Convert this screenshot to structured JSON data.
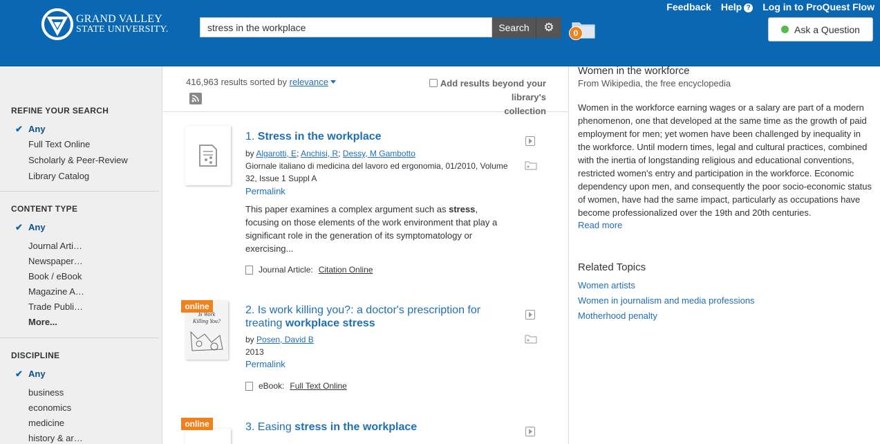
{
  "header": {
    "logo_line1": "GRAND VALLEY",
    "logo_line2": "STATE UNIVERSITY.",
    "search_value": "stress in the workplace",
    "search_button": "Search",
    "folder_count": "0",
    "feedback": "Feedback",
    "help": "Help",
    "help_q": "?",
    "login": "Log in to ProQuest Flow",
    "ask": "Ask a Question"
  },
  "sidebar": {
    "refine_title": "REFINE YOUR SEARCH",
    "refine_items": [
      "Any",
      "Full Text Online",
      "Scholarly & Peer-Review",
      "Library Catalog"
    ],
    "content_title": "CONTENT TYPE",
    "content_items": [
      "Any",
      "Journal Arti…",
      "Newspaper…",
      "Book / eBook",
      "Magazine A…",
      "Trade Publi…",
      "More..."
    ],
    "discipline_title": "DISCIPLINE",
    "discipline_items": [
      "Any",
      "business",
      "economics",
      "medicine",
      "history & ar…"
    ]
  },
  "results_header": {
    "count_text": "416,963 results sorted by",
    "sort_value": "relevance",
    "beyond_line1": "Add results beyond your library's",
    "beyond_line2": "collection"
  },
  "results": [
    {
      "num": "1.",
      "title_plain": "",
      "title_bold": "Stress in the workplace",
      "by": "by",
      "authors": [
        "Algarotti, E",
        "Anchisi, R",
        "Dessy, M Gambotto"
      ],
      "pub1": "Giornale italiano di medicina del lavoro ed ergonomia, 01/2010, Volume",
      "pub2": "32, Issue 1 Suppl A",
      "permalink": "Permalink",
      "snippet_pre": "This paper examines a complex argument such as ",
      "snippet_bold": "stress",
      "snippet_post": ", focusing on those elements of the work environment that play a significant role in the generation of its symptomatology or exercising...",
      "format_label": "Journal Article:",
      "format_link": "Citation Online"
    },
    {
      "num": "2.",
      "title_plain": "Is work killing you?: a doctor's prescription for treating ",
      "title_bold": "workplace stress",
      "online": "online",
      "by": "by",
      "authors": [
        "Posen, David B"
      ],
      "year": "2013",
      "permalink": "Permalink",
      "format_label": "eBook:",
      "format_link": "Full Text Online"
    },
    {
      "num": "3.",
      "title_plain": "Easing ",
      "title_bold": "stress in the workplace",
      "online": "online"
    }
  ],
  "wiki": {
    "title": "Women in the workforce",
    "source": "From Wikipedia, the free encyclopedia",
    "body": "Women in the workforce earning wages or a salary are part of a modern phenomenon, one that developed at the same time as the growth of paid employment for men; yet women have been challenged by inequality in the workforce. Until modern times, legal and cultural practices, combined with the inertia of longstanding religious and educational conventions, restricted women's entry and participation in the workforce. Economic dependency upon men, and consequently the poor socio-economic status of women, have had the same impact, particularly as occupations have become professionalized over the 19th and 20th centuries.",
    "read_more": "Read more",
    "related_title": "Related Topics",
    "related": [
      "Women artists",
      "Women in journalism and media professions",
      "Motherhood penalty"
    ]
  }
}
